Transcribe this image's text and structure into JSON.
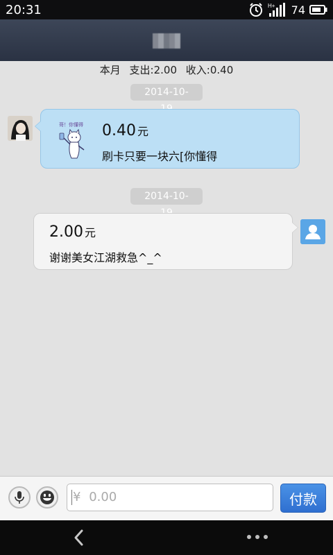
{
  "status_bar": {
    "time": "20:31",
    "network": "H+",
    "battery": "74"
  },
  "title_bar": {
    "title": ""
  },
  "summary": {
    "month": "本月",
    "expense": "支出:2.00",
    "income": "收入:0.40"
  },
  "messages": [
    {
      "date": "2014-10-19",
      "direction": "incoming",
      "amount": "0.40",
      "unit": "元",
      "text": "刷卡只要一块六[你懂得",
      "sticker": "cat-sticker",
      "sticker_text": "哥！你懂得"
    },
    {
      "date": "2014-10-19",
      "direction": "outgoing",
      "amount": "2.00",
      "unit": "元",
      "text": "谢谢美女江湖救急^_^"
    }
  ],
  "input": {
    "currency_symbol": "¥",
    "placeholder": "0.00",
    "pay_label": "付款"
  },
  "icons": {
    "alarm": "alarm-icon",
    "signal": "signal-icon",
    "battery": "battery-icon",
    "mic": "microphone-icon",
    "emoji": "emoji-icon",
    "back": "back-icon",
    "menu": "overflow-menu-icon"
  },
  "colors": {
    "incoming_bubble": "#bcdff5",
    "outgoing_bubble": "#f4f4f4",
    "pay_button": "#3a7fdc",
    "title_bar": "#343c4d"
  }
}
